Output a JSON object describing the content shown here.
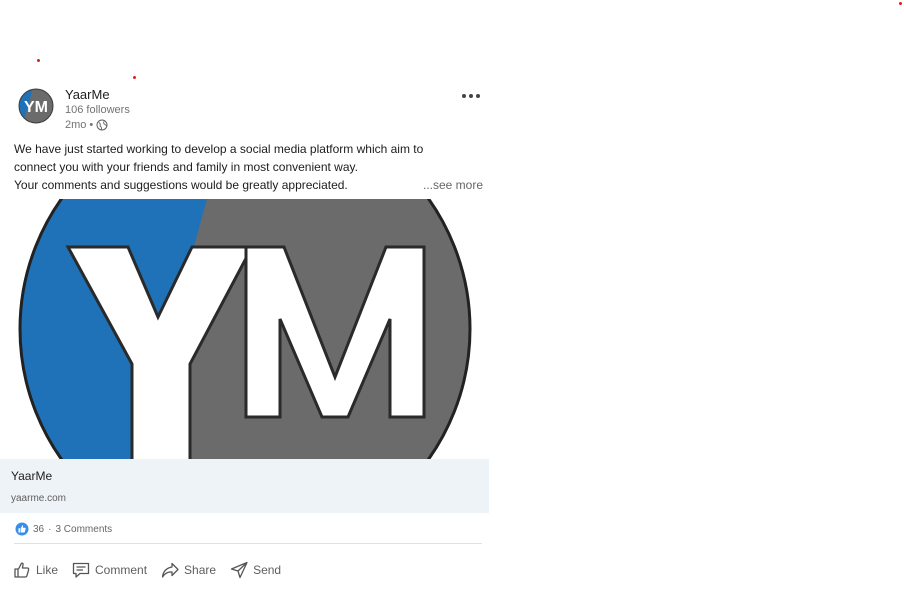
{
  "post": {
    "author_name": "YaarMe",
    "followers": "106 followers",
    "time": "2mo",
    "separator": "•",
    "avatar_text": "YM",
    "body_line1": "We have just started working to develop a social media platform which aim to",
    "body_line2": "connect you with your friends and family in most convenient way.",
    "body_line3": "Your comments and suggestions would be greatly appreciated.",
    "see_more": "...see more"
  },
  "link_card": {
    "title": "YaarMe",
    "url": "yaarme.com"
  },
  "stats": {
    "reactions": "36",
    "separator": "·",
    "comments": "3 Comments"
  },
  "actions": {
    "like": "Like",
    "comment": "Comment",
    "share": "Share",
    "send": "Send"
  },
  "colors": {
    "brand_blue": "#1f72b8",
    "brand_gray": "#6b6b6b",
    "link_card_bg": "#eef3f8",
    "like_blue": "#378fe9"
  },
  "icons": [
    "more-icon",
    "globe-icon",
    "like-reaction-icon",
    "like-icon",
    "comment-icon",
    "share-icon",
    "send-icon"
  ]
}
